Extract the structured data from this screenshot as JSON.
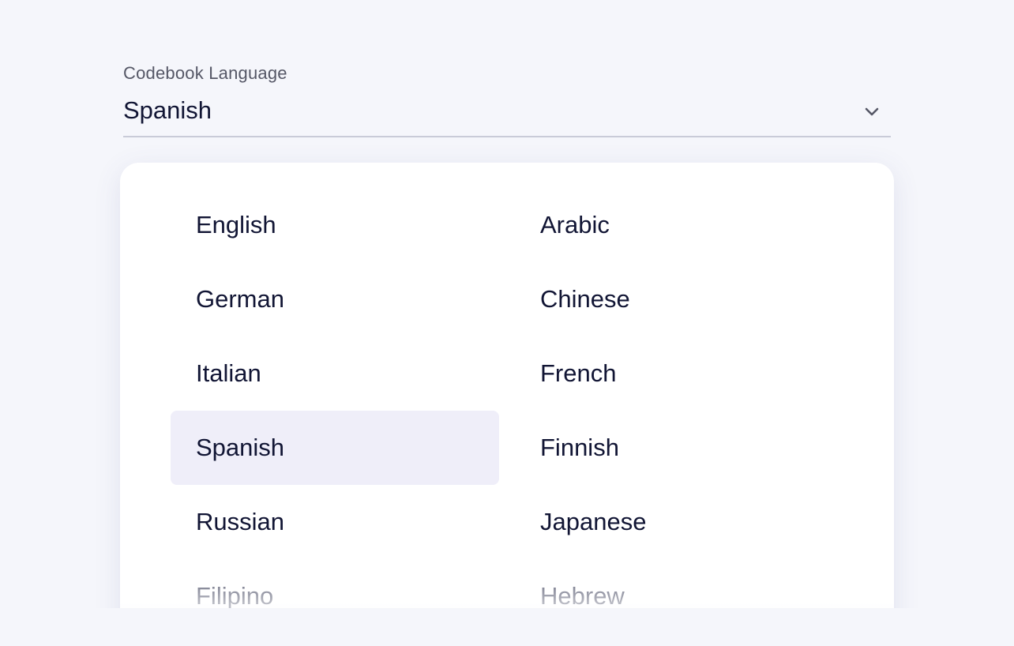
{
  "select": {
    "label": "Codebook Language",
    "value": "Spanish",
    "icon": "chevron-down-icon"
  },
  "options": {
    "left": [
      {
        "label": "English"
      },
      {
        "label": "German"
      },
      {
        "label": "Italian"
      },
      {
        "label": "Spanish",
        "selected": true
      },
      {
        "label": "Russian"
      },
      {
        "label": "Filipino"
      }
    ],
    "right": [
      {
        "label": "Arabic"
      },
      {
        "label": "Chinese"
      },
      {
        "label": "French"
      },
      {
        "label": "Finnish"
      },
      {
        "label": "Japanese"
      },
      {
        "label": "Hebrew"
      }
    ]
  },
  "colors": {
    "text": "#111534",
    "selected_bg": "#efeef9",
    "page_bg": "#f5f6fb"
  }
}
